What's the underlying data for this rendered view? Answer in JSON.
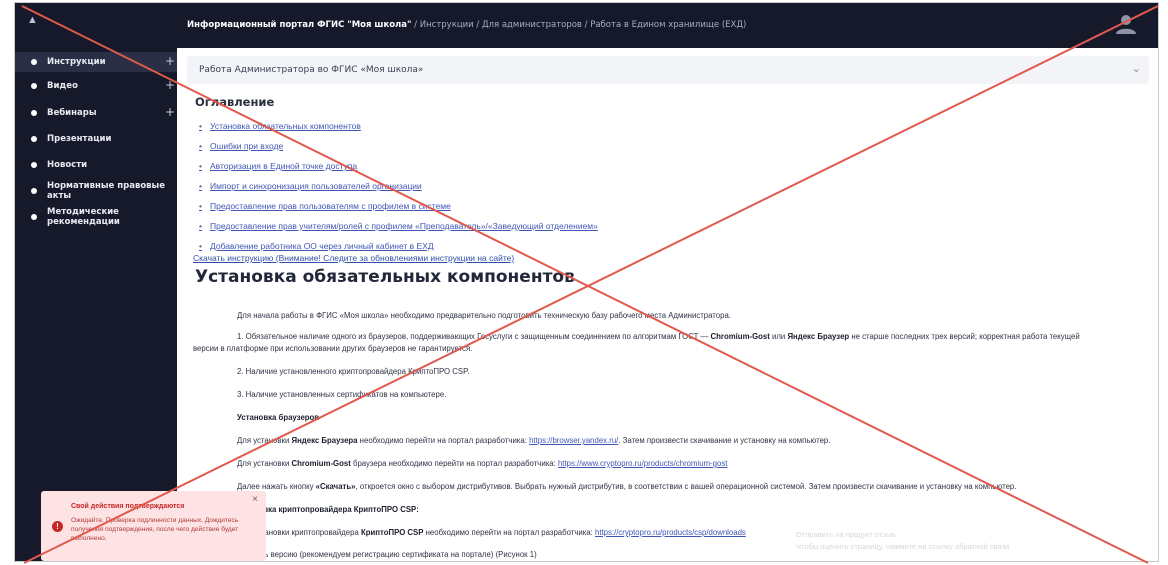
{
  "header": {
    "breadcrumb_root": "Информационный портал ФГИС \"Моя школа\"",
    "breadcrumb_sep": " / ",
    "breadcrumb_1": "Инструкции",
    "breadcrumb_2": "Для администраторов",
    "breadcrumb_3": "Работа в Едином хранилище (ЕХД)",
    "menu_icon": "menu-icon",
    "user_icon": "user-icon"
  },
  "sidebar": {
    "items": [
      {
        "label": "Инструкции",
        "expandable": true
      },
      {
        "label": "Видео",
        "expandable": true
      },
      {
        "label": "Вебинары",
        "expandable": true
      },
      {
        "label": "Презентации",
        "expandable": false
      },
      {
        "label": "Новости",
        "expandable": false
      },
      {
        "label": "Нормативные правовые акты",
        "expandable": false
      },
      {
        "label": "Методические рекомендации",
        "expandable": false
      }
    ],
    "plus": "+"
  },
  "section": {
    "title": "Работа Администратора во ФГИС «Моя школа»",
    "chevron": "⌄"
  },
  "toc": {
    "title": "Оглавление",
    "items": [
      "Установка обязательных компонентов",
      "Ошибки при входе",
      "Авторизация в Единой точке доступа",
      "Импорт и синхронизация пользователей организации",
      "Предоставление прав пользователям с профилем в системе",
      "Предоставление прав учителям/ролей с профилем «Преподаватель»/«Заведующий отделением»",
      "Добавление работника ОО через личный кабинет в ЕХД"
    ],
    "download": "Скачать инструкцию (Внимание! Следите за обновлениями инструкции на сайте)"
  },
  "content": {
    "heading": "Установка обязательных компонентов",
    "p1": "Для начала работы в ФГИС «Моя школа» необходимо предварительно подготовить техническую базу рабочего места Администратора.",
    "p2a": "1. Обязательное наличие одного из браузеров, поддерживающих Госуслуги с защищенным соединением по алгоритмам ГОСТ — ",
    "p2b": "Chromium-Gost",
    "p2c": " или ",
    "p2d": "Яндекс Браузер",
    "p2e": " не старше последних трех версий; корректная работа текущей",
    "p2f": "версии в платформе при использовании других браузеров не гарантируется.",
    "p3": "2. Наличие установленного криптопровайдера КриптоПРО CSP.",
    "p4": "3. Наличие установленных сертификатов на компьютере.",
    "p5": "Установка браузеров",
    "p6a": "Для установки ",
    "p6b": "Яндекс Браузера",
    "p6c": " необходимо перейти на портал разработчика: ",
    "p6d": "https://browser.yandex.ru/",
    "p6e": ". Затем произвести скачивание и установку на компьютер.",
    "p7a": "Для установки ",
    "p7b": "Chromium-Gost",
    "p7c": " браузера необходимо перейти на портал разработчика: ",
    "p7d": "https://www.cryptopro.ru/products/chromium-gost",
    "p8a": "Далее нажать кнопку ",
    "p8b": "«Скачать»",
    "p8c": ", откроется окно с выбором дистрибутивов. Выбрать нужный дистрибутив, в соответствии с вашей операционной системой. Затем произвести скачивание и установку на компьютер.",
    "p9": "Установка криптопровайдера КриптоПРО CSP:",
    "p10a": "Для установки криптопровайдера ",
    "p10b": "КриптоПРО CSP",
    "p10c": " необходимо перейти на портал разработчика: ",
    "p10d": "https://cryptopro.ru/products/csp/downloads",
    "p11": "Выбрать версию (рекомендуем регистрацию сертификата на портале) (Рисунок 1)"
  },
  "toast": {
    "title": "Свой действия подтверждаются",
    "body": "Ожидайте. Проверка подлинности данных. Дождитесь получения подтверждения, после чего действие будет выполнено.",
    "close": "×",
    "icon": "error-icon"
  },
  "ghost": {
    "line1": "Отправить на продукт отзыв",
    "line2": "Чтобы оценить страницу, нажмите на ссылку обратной связи"
  },
  "colors": {
    "nav_bg": "#16192a",
    "link": "#3f56b4",
    "cross": "#e05a4e",
    "toast_bg": "#fde3e3"
  }
}
